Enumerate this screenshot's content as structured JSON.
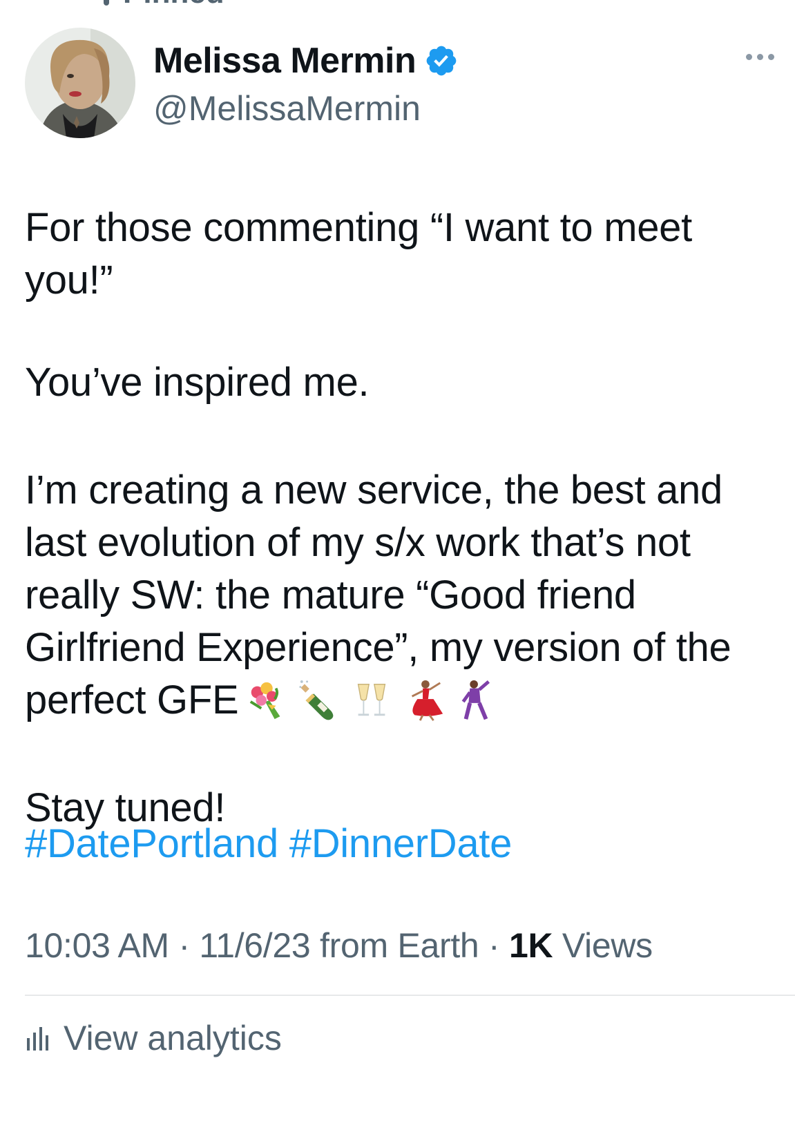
{
  "header": {
    "pinned_label": "Pinned"
  },
  "author": {
    "display_name": "Melissa Mermin",
    "handle": "@MelissaMermin",
    "verified": true
  },
  "tweet": {
    "line_1": "For those commenting “I want to meet",
    "line_2": "you!”",
    "line_3": "You’ve inspired me.",
    "line_4": "I’m creating a new service, the best and",
    "line_5": "last evolution of my s/x work that’s not",
    "line_6": "really SW: the mature “Good friend",
    "line_7": "Girlfriend Experience”, my version of the",
    "line_8": "perfect GFE",
    "emojis": [
      "bouquet-icon",
      "champagne-bottle-icon",
      "clinking-glasses-icon",
      "dancing-woman-icon",
      "dancing-man-icon"
    ],
    "line_9": "Stay tuned!",
    "hashtags": [
      "#DatePortland",
      "#DinnerDate"
    ]
  },
  "meta": {
    "time": "10:03 AM",
    "separator_1": " · ",
    "date": "11/6/23",
    "source": " from Earth",
    "separator_2": " · ",
    "views_count": "1K",
    "views_label": " Views"
  },
  "analytics": {
    "label": "View analytics"
  },
  "colors": {
    "link": "#1d9bf0",
    "secondary_text": "#536471",
    "primary_text": "#0f1419",
    "verified": "#1d9bf0"
  }
}
